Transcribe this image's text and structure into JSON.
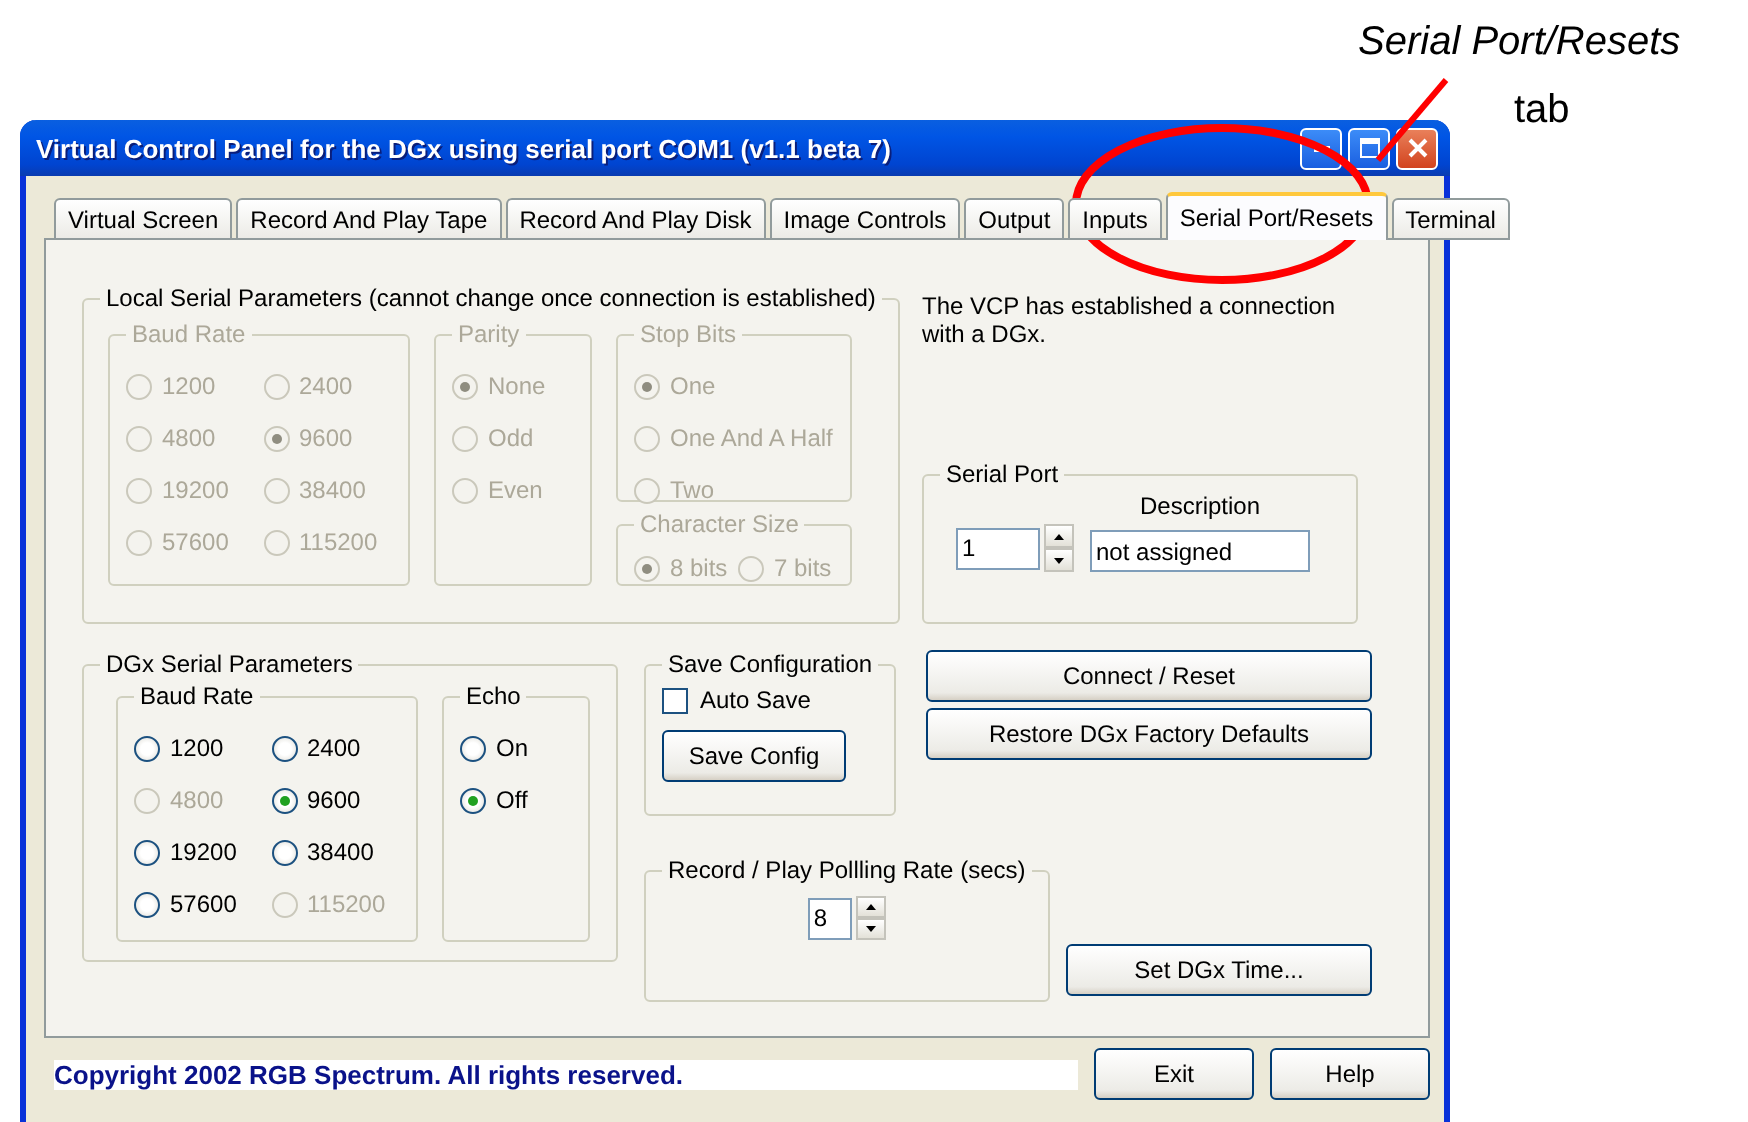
{
  "annotation": {
    "title": "Serial Port/Resets",
    "subtitle": "tab"
  },
  "window": {
    "title": "Virtual Control Panel for the DGx using serial port COM1 (v1.1 beta 7)"
  },
  "tabs": [
    {
      "label": "Virtual Screen",
      "selected": false
    },
    {
      "label": "Record And Play Tape",
      "selected": false
    },
    {
      "label": "Record And Play Disk",
      "selected": false
    },
    {
      "label": "Image Controls",
      "selected": false
    },
    {
      "label": "Output",
      "selected": false
    },
    {
      "label": "Inputs",
      "selected": false
    },
    {
      "label": "Serial Port/Resets",
      "selected": true
    },
    {
      "label": "Terminal",
      "selected": false
    }
  ],
  "local_serial": {
    "title": "Local Serial Parameters (cannot change once connection is established)",
    "baud_rate": {
      "title": "Baud Rate",
      "disabled": true,
      "options": [
        {
          "label": "1200",
          "selected": false,
          "disabled": true
        },
        {
          "label": "2400",
          "selected": false,
          "disabled": true
        },
        {
          "label": "4800",
          "selected": false,
          "disabled": true
        },
        {
          "label": "9600",
          "selected": true,
          "disabled": true
        },
        {
          "label": "19200",
          "selected": false,
          "disabled": true
        },
        {
          "label": "38400",
          "selected": false,
          "disabled": true
        },
        {
          "label": "57600",
          "selected": false,
          "disabled": true
        },
        {
          "label": "115200",
          "selected": false,
          "disabled": true
        }
      ]
    },
    "parity": {
      "title": "Parity",
      "disabled": true,
      "options": [
        {
          "label": "None",
          "selected": true,
          "disabled": true
        },
        {
          "label": "Odd",
          "selected": false,
          "disabled": true
        },
        {
          "label": "Even",
          "selected": false,
          "disabled": true
        }
      ]
    },
    "stop_bits": {
      "title": "Stop Bits",
      "disabled": true,
      "options": [
        {
          "label": "One",
          "selected": true,
          "disabled": true
        },
        {
          "label": "One And A Half",
          "selected": false,
          "disabled": true
        },
        {
          "label": "Two",
          "selected": false,
          "disabled": true
        }
      ]
    },
    "character_size": {
      "title": "Character Size",
      "disabled": true,
      "options": [
        {
          "label": "8 bits",
          "selected": true,
          "disabled": true
        },
        {
          "label": "7 bits",
          "selected": false,
          "disabled": true
        }
      ]
    }
  },
  "status_text": "The VCP has established a connection with a DGx.",
  "serial_port": {
    "title": "Serial Port",
    "port": "1",
    "description_label": "Description",
    "description": "not assigned"
  },
  "dgx_serial": {
    "title": "DGx Serial Parameters",
    "baud_rate": {
      "title": "Baud Rate",
      "disabled": false,
      "options": [
        {
          "label": "1200",
          "selected": false,
          "disabled": false
        },
        {
          "label": "2400",
          "selected": false,
          "disabled": false
        },
        {
          "label": "4800",
          "selected": false,
          "disabled": true
        },
        {
          "label": "9600",
          "selected": true,
          "disabled": false
        },
        {
          "label": "19200",
          "selected": false,
          "disabled": false
        },
        {
          "label": "38400",
          "selected": false,
          "disabled": false
        },
        {
          "label": "57600",
          "selected": false,
          "disabled": false
        },
        {
          "label": "115200",
          "selected": false,
          "disabled": true
        }
      ]
    },
    "echo": {
      "title": "Echo",
      "disabled": false,
      "options": [
        {
          "label": "On",
          "selected": false,
          "disabled": false
        },
        {
          "label": "Off",
          "selected": true,
          "disabled": false
        }
      ]
    }
  },
  "save_configuration": {
    "title": "Save Configuration",
    "auto_save": {
      "label": "Auto Save",
      "checked": false
    },
    "button": "Save Config"
  },
  "polling": {
    "title": "Record / Play Pollling Rate (secs)",
    "value": "8"
  },
  "actions": {
    "connect": "Connect / Reset",
    "restore": "Restore DGx Factory Defaults",
    "set_time": "Set DGx Time..."
  },
  "footer": {
    "copyright": "Copyright 2002 RGB Spectrum.  All rights reserved.",
    "buttons": [
      "Exit",
      "Help"
    ]
  }
}
